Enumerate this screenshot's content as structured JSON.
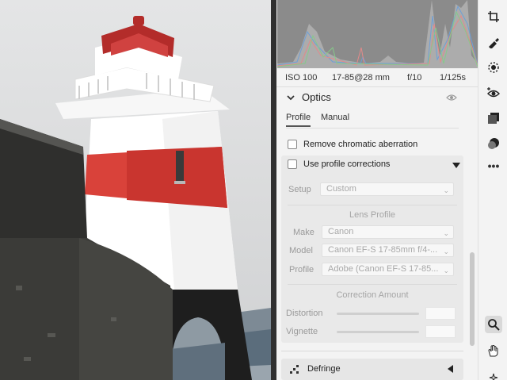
{
  "exif": {
    "iso": "ISO 100",
    "focal": "17-85@28 mm",
    "aperture": "f/10",
    "shutter": "1/125s"
  },
  "optics": {
    "title": "Optics",
    "tabs": [
      {
        "label": "Profile",
        "active": true
      },
      {
        "label": "Manual",
        "active": false
      }
    ],
    "remove_ca_label": "Remove chromatic aberration",
    "remove_ca_checked": false,
    "use_profile_label": "Use profile corrections",
    "use_profile_checked": false,
    "setup_label": "Setup",
    "setup_value": "Custom",
    "lens_profile_heading": "Lens Profile",
    "make_label": "Make",
    "make_value": "Canon",
    "model_label": "Model",
    "model_value": "Canon EF-S 17-85mm f/4-...",
    "profile_label": "Profile",
    "profile_value": "Adobe (Canon EF-S 17-85...",
    "correction_heading": "Correction Amount",
    "distortion_label": "Distortion",
    "vignette_label": "Vignette"
  },
  "defringe": {
    "title": "Defringe"
  },
  "toolbar": {
    "tools": [
      {
        "name": "crop-icon"
      },
      {
        "name": "healing-brush-icon"
      },
      {
        "name": "masking-icon"
      },
      {
        "name": "red-eye-icon"
      },
      {
        "name": "presets-icon"
      },
      {
        "name": "snapshots-icon"
      },
      {
        "name": "more-icon"
      },
      {
        "name": "zoom-icon",
        "active": true
      },
      {
        "name": "hand-icon"
      },
      {
        "name": "sparkle-icon"
      }
    ]
  },
  "colors": {
    "lighthouse_red": "#d9423a",
    "histogram_bg": "#8b8b8b",
    "panel_bg": "#f3f3f3"
  }
}
